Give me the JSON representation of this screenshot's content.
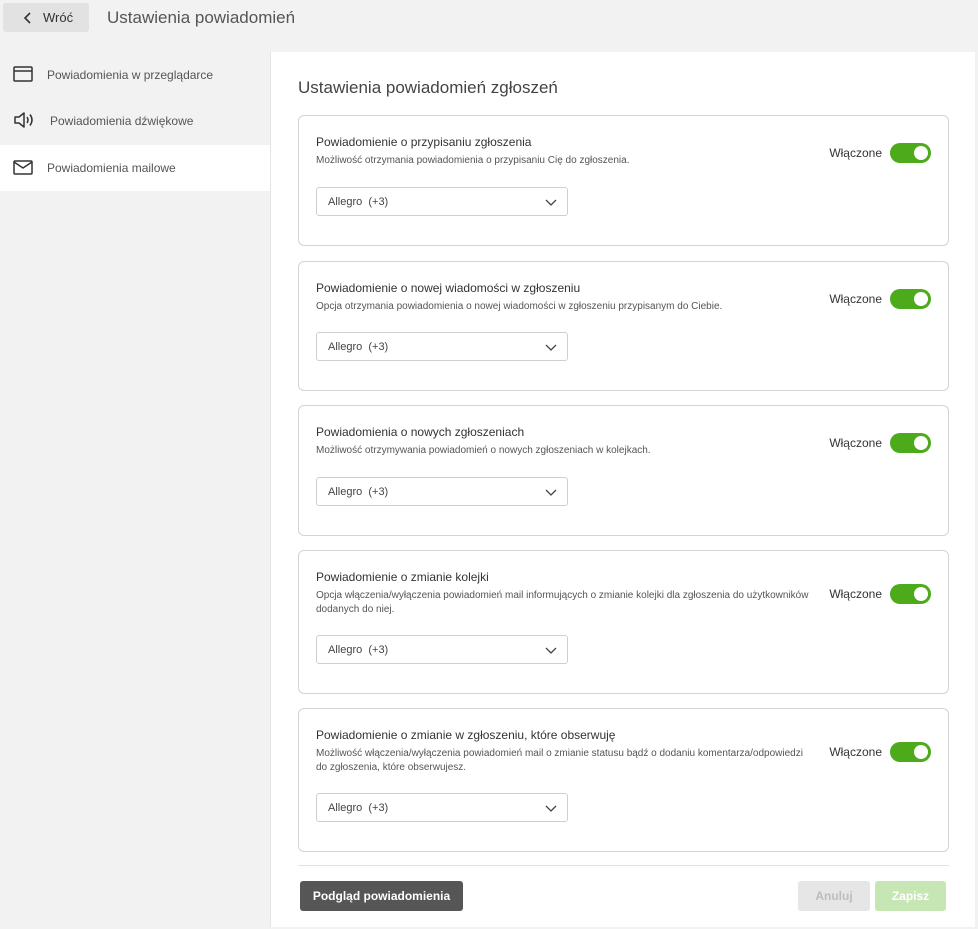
{
  "header": {
    "back_label": "Wróć",
    "title": "Ustawienia powiadomień"
  },
  "sidebar": {
    "items": [
      {
        "label": "Powiadomienia w przeglądarce",
        "icon": "browser-window-icon",
        "active": false
      },
      {
        "label": "Powiadomienia dźwiękowe",
        "icon": "speaker-icon",
        "active": false
      },
      {
        "label": "Powiadomienia mailowe",
        "icon": "envelope-icon",
        "active": true
      }
    ]
  },
  "main": {
    "section_title": "Ustawienia powiadomień zgłoszeń",
    "cards": [
      {
        "title": "Powiadomienie o przypisaniu zgłoszenia",
        "description": "Możliwość otrzymania powiadomienia o przypisaniu Cię do zgłoszenia.",
        "toggle_label": "Włączone",
        "enabled": true,
        "select_value": "Allegro  (+3)"
      },
      {
        "title": "Powiadomienie o nowej wiadomości w zgłoszeniu",
        "description": "Opcja otrzymania powiadomienia o nowej wiadomości w zgłoszeniu przypisanym do Ciebie.",
        "toggle_label": "Włączone",
        "enabled": true,
        "select_value": "Allegro  (+3)"
      },
      {
        "title": "Powiadomienia o nowych zgłoszeniach",
        "description": "Możliwość otrzymywania powiadomień o nowych zgłoszeniach w kolejkach.",
        "toggle_label": "Włączone",
        "enabled": true,
        "select_value": "Allegro  (+3)"
      },
      {
        "title": "Powiadomienie o zmianie kolejki",
        "description": "Opcja włączenia/wyłączenia powiadomień mail informujących o zmianie kolejki dla zgłoszenia do użytkowników dodanych do niej.",
        "toggle_label": "Włączone",
        "enabled": true,
        "select_value": "Allegro  (+3)"
      },
      {
        "title": "Powiadomienie o zmianie w zgłoszeniu, które obserwuję",
        "description": "Możliwość włączenia/wyłączenia powiadomień mail o zmianie statusu bądź o dodaniu komentarza/odpowiedzi do zgłoszenia, które obserwujesz.",
        "toggle_label": "Włączone",
        "enabled": true,
        "select_value": "Allegro  (+3)"
      }
    ]
  },
  "footer": {
    "preview_label": "Podgląd powiadomienia",
    "cancel_label": "Anuluj",
    "save_label": "Zapisz"
  },
  "colors": {
    "toggle_on": "#4caa1b",
    "preview_button": "#565656",
    "save_disabled": "#c6e7b4",
    "cancel_disabled": "#e6e6e6"
  }
}
